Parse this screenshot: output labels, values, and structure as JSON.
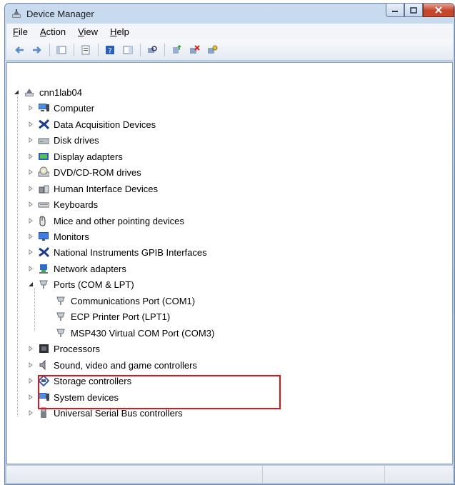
{
  "window": {
    "title": "Device Manager"
  },
  "menu": [
    {
      "accel": "F",
      "rest": "ile"
    },
    {
      "accel": "A",
      "rest": "ction"
    },
    {
      "accel": "V",
      "rest": "iew"
    },
    {
      "accel": "H",
      "rest": "elp"
    }
  ],
  "toolbar": [
    "back-icon",
    "forward-icon",
    "sep",
    "show-hide-console-tree-icon",
    "sep",
    "properties-icon",
    "sep",
    "help-icon",
    "action-pane-icon",
    "sep",
    "scan-hardware-icon",
    "sep",
    "update-driver-icon",
    "uninstall-icon",
    "disable-icon"
  ],
  "tree": {
    "root": "cnn1lab04",
    "categories": [
      "Computer",
      "Data Acquisition Devices",
      "Disk drives",
      "Display adapters",
      "DVD/CD-ROM drives",
      "Human Interface Devices",
      "Keyboards",
      "Mice and other pointing devices",
      "Monitors",
      "National Instruments GPIB Interfaces",
      "Network adapters",
      "Ports (COM & LPT)",
      "Processors",
      "Sound, video and game controllers",
      "Storage controllers",
      "System devices",
      "Universal Serial Bus controllers"
    ],
    "ports": [
      "Communications Port (COM1)",
      "ECP Printer Port (LPT1)",
      "MSP430 Virtual COM Port (COM3)"
    ]
  },
  "colors": {
    "highlight_box": "#e0141b",
    "selection": "#dcebfc"
  }
}
